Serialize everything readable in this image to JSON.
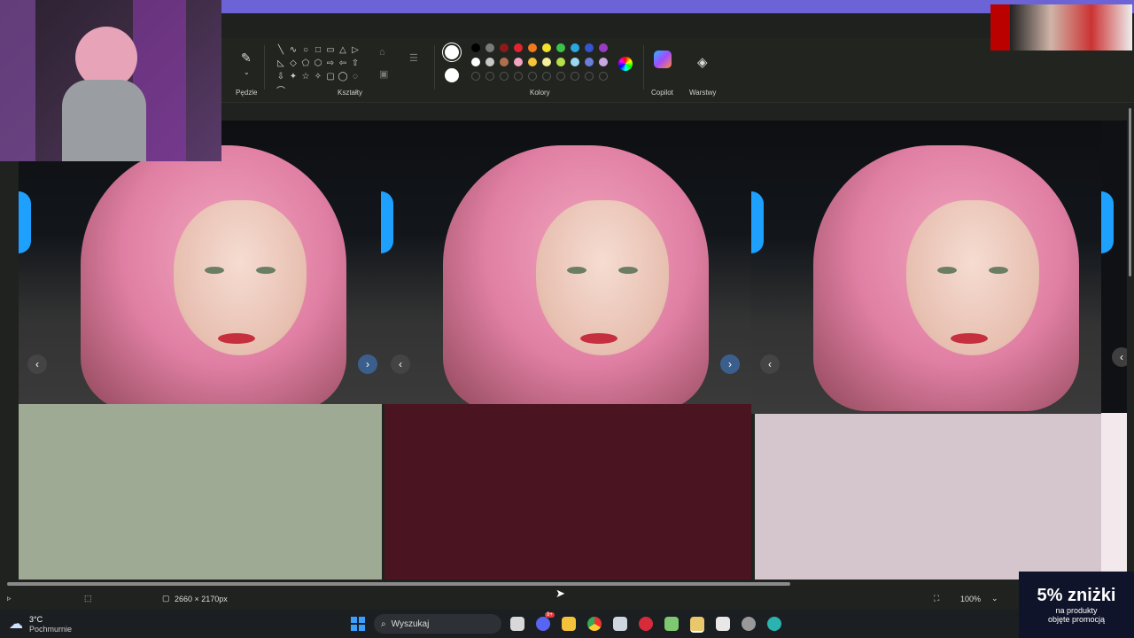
{
  "ribbon": {
    "brushes_label": "Pędzle",
    "shapes_label": "Kształty",
    "colors_label": "Kolory",
    "copilot_label": "Copilot",
    "layers_label": "Warstwy",
    "shape_glyphs": [
      "╲",
      "∿",
      "○",
      "□",
      "▭",
      "△",
      "▷",
      "◺",
      "◇",
      "⬠",
      "⬡",
      "⇨",
      "⇦",
      "⇧",
      "⇩",
      "✦",
      "☆",
      "✧",
      "▢",
      "◯",
      "◌",
      "⌒"
    ],
    "palette_row1": [
      "#000000",
      "#7a7a7a",
      "#8c1a1a",
      "#e02430",
      "#f07a1e",
      "#f2e12a",
      "#3cc24a",
      "#2aa7e0",
      "#3454d0",
      "#9a3cc0"
    ],
    "palette_row2": [
      "#ffffff",
      "#c8c8c8",
      "#b07050",
      "#f4a3c0",
      "#f6c33a",
      "#f5ef9a",
      "#b8e04a",
      "#9ad8f0",
      "#6a7fd8",
      "#c8a8e0"
    ],
    "brand_color": "#6b63d6"
  },
  "statusbar": {
    "canvas_size": "2660 × 2170px",
    "zoom": "100%"
  },
  "taskbar": {
    "weather_temp": "3°C",
    "weather_desc": "Pochmurnie",
    "search_placeholder": "Wyszukaj",
    "notification_badge": "9+"
  },
  "overlay": {
    "promo_big": "5% zniżki",
    "promo_line1": "na produkty",
    "promo_line2": "objęte promocją"
  },
  "canvas": {
    "panels": [
      {
        "fabric": "#9faa95"
      },
      {
        "fabric": "#4a1420"
      },
      {
        "fabric": "#d4c6cc"
      }
    ]
  }
}
